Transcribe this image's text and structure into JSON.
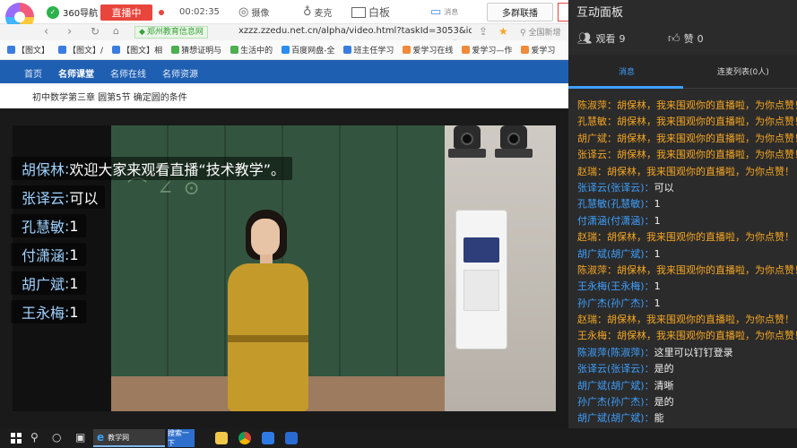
{
  "toolbar": {
    "browser_tab": "360导航",
    "live_button": "直播中",
    "timer": "00:02:35",
    "camera_label": "摄像",
    "mic_label": "麦克",
    "whiteboard_label": "白板",
    "message_label": "消息",
    "multi_group_button": "多群联播"
  },
  "address_bar": {
    "site_tag": "郑州教育信息网",
    "url": "xzzz.zzedu.net.cn/alpha/video.html?taskId=3053&id",
    "search_placeholder": "全国新增"
  },
  "bookmarks": [
    {
      "label": "【图文】",
      "color": "#3a7de0"
    },
    {
      "label": "【图文】/",
      "color": "#3a7de0"
    },
    {
      "label": "【图文】相",
      "color": "#3a7de0"
    },
    {
      "label": "猜想证明与",
      "color": "#4caf50"
    },
    {
      "label": "生活中的",
      "color": "#4caf50"
    },
    {
      "label": "百度网盘-全",
      "color": "#2a8cf0"
    },
    {
      "label": "班主任学习",
      "color": "#3a7de0"
    },
    {
      "label": "爱学习在线",
      "color": "#f08a3a"
    },
    {
      "label": "爱学习—作",
      "color": "#f08a3a"
    },
    {
      "label": "爱学习",
      "color": "#f08a3a"
    }
  ],
  "site_nav": {
    "home": "首页",
    "kecheng": "名师课堂",
    "zaixian": "名师在线",
    "ziyuan": "名师资源"
  },
  "lesson_title": "初中数学第三章 圆第5节 确定圆的条件",
  "video_overlay": [
    {
      "name": "胡保林",
      "text": "欢迎大家来观看直播“技术教学”。"
    },
    {
      "name": "张译云",
      "text": "可以"
    },
    {
      "name": "孔慧敏",
      "text": "1"
    },
    {
      "name": "付潇涵",
      "text": "1"
    },
    {
      "name": "胡广斌",
      "text": "1"
    },
    {
      "name": "王永梅",
      "text": "1"
    }
  ],
  "taskbar": {
    "ie_label": "教学网",
    "search_box": "搜索一下"
  },
  "panel": {
    "title": "互动面板",
    "watch_label": "观看",
    "watch_count": "9",
    "like_label": "赞",
    "like_count": "0",
    "tab_messages": "消息",
    "tab_connect": "连麦列表(0人)",
    "messages": [
      {
        "name": "陈淑萍",
        "text": "胡保林，我来围观你的直播啦，为你点赞！",
        "type": "gift"
      },
      {
        "name": "孔慧敏",
        "text": "胡保林，我来围观你的直播啦，为你点赞！",
        "type": "gift"
      },
      {
        "name": "胡广斌",
        "text": "胡保林，我来围观你的直播啦，为你点赞！",
        "type": "gift"
      },
      {
        "name": "张译云",
        "text": "胡保林，我来围观你的直播啦，为你点赞！",
        "type": "gift"
      },
      {
        "name": "赵瑞",
        "text": "胡保林，我来围观你的直播啦，为你点赞！",
        "type": "gift"
      },
      {
        "name": "张译云(张译云)",
        "text": "可以",
        "type": "chat"
      },
      {
        "name": "孔慧敏(孔慧敏)",
        "text": "1",
        "type": "chat"
      },
      {
        "name": "付潇涵(付潇涵)",
        "text": "1",
        "type": "chat"
      },
      {
        "name": "赵瑞",
        "text": "胡保林，我来围观你的直播啦，为你点赞！",
        "type": "gift"
      },
      {
        "name": "胡广斌(胡广斌)",
        "text": "1",
        "type": "chat"
      },
      {
        "name": "陈淑萍",
        "text": "胡保林，我来围观你的直播啦，为你点赞！",
        "type": "gift"
      },
      {
        "name": "王永梅(王永梅)",
        "text": "1",
        "type": "chat"
      },
      {
        "name": "孙广杰(孙广杰)",
        "text": "1",
        "type": "chat"
      },
      {
        "name": "赵瑞",
        "text": "胡保林，我来围观你的直播啦，为你点赞！",
        "type": "gift"
      },
      {
        "name": "王永梅",
        "text": "胡保林，我来围观你的直播啦，为你点赞！",
        "type": "gift"
      },
      {
        "name": "陈淑萍(陈淑萍)",
        "text": "这里可以钉钉登录",
        "type": "chat"
      },
      {
        "name": "张译云(张译云)",
        "text": "是的",
        "type": "chat"
      },
      {
        "name": "胡广斌(胡广斌)",
        "text": "清晰",
        "type": "chat"
      },
      {
        "name": "孙广杰(孙广杰)",
        "text": "是的",
        "type": "chat"
      },
      {
        "name": "胡广斌(胡广斌)",
        "text": "能",
        "type": "chat"
      },
      {
        "name": "付潇涵(付潇涵)",
        "text": "能",
        "type": "chat"
      }
    ]
  },
  "colors": {
    "live_red": "#e8453c",
    "site_blue": "#1f5fb2",
    "panel_bg": "#2b2b2b",
    "name_blue": "#3ea0ff",
    "gift_orange": "#f5a623"
  }
}
